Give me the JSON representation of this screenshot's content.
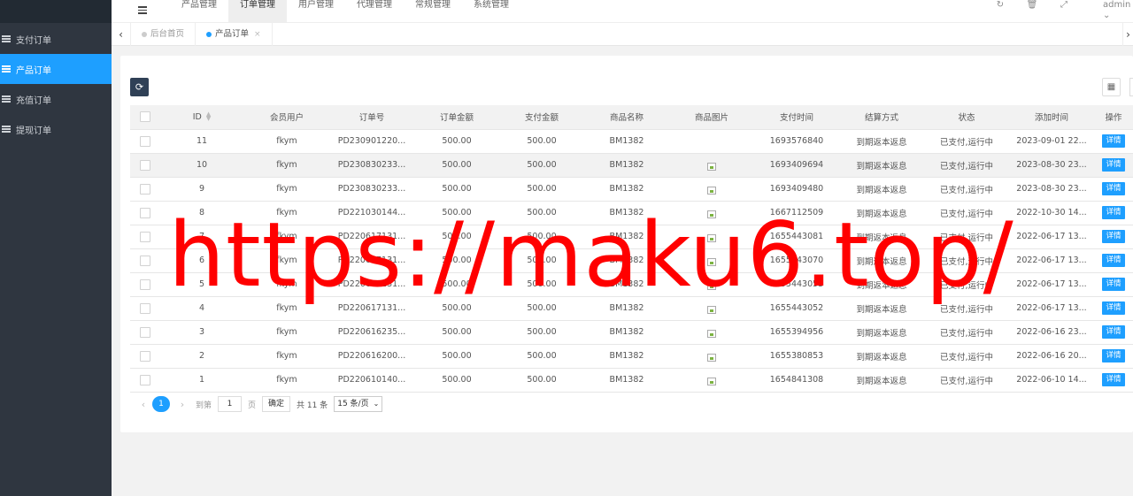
{
  "header": {
    "nav": [
      "产品管理",
      "订单管理",
      "用户管理",
      "代理管理",
      "常规管理",
      "系统管理"
    ],
    "active_nav": 1,
    "user": "admin"
  },
  "sidebar": {
    "items": [
      {
        "label": "支付订单",
        "active": false
      },
      {
        "label": "产品订单",
        "active": true
      },
      {
        "label": "充值订单",
        "active": false
      },
      {
        "label": "提现订单",
        "active": false
      }
    ]
  },
  "tabs": [
    {
      "label": "后台首页",
      "active": false
    },
    {
      "label": "产品订单",
      "active": true
    }
  ],
  "table": {
    "columns": [
      "",
      "ID",
      "会员用户",
      "订单号",
      "订单金额",
      "支付金额",
      "商品名称",
      "商品图片",
      "支付时间",
      "结算方式",
      "状态",
      "添加时间",
      "操作"
    ],
    "detail_label": "详情",
    "rows": [
      {
        "id": "11",
        "user": "fkym",
        "order_no": "PD230901220...",
        "amount": "500.00",
        "paid": "500.00",
        "product": "BM1382",
        "image": false,
        "pay_time": "1693576840",
        "settle": "到期返本返息",
        "status": "已支付,运行中",
        "added": "2023-09-01 22..."
      },
      {
        "id": "10",
        "user": "fkym",
        "order_no": "PD230830233...",
        "amount": "500.00",
        "paid": "500.00",
        "product": "BM1382",
        "image": true,
        "pay_time": "1693409694",
        "settle": "到期返本返息",
        "status": "已支付,运行中",
        "added": "2023-08-30 23..."
      },
      {
        "id": "9",
        "user": "fkym",
        "order_no": "PD230830233...",
        "amount": "500.00",
        "paid": "500.00",
        "product": "BM1382",
        "image": true,
        "pay_time": "1693409480",
        "settle": "到期返本返息",
        "status": "已支付,运行中",
        "added": "2023-08-30 23..."
      },
      {
        "id": "8",
        "user": "fkym",
        "order_no": "PD221030144...",
        "amount": "500.00",
        "paid": "500.00",
        "product": "BM1382",
        "image": true,
        "pay_time": "1667112509",
        "settle": "到期返本返息",
        "status": "已支付,运行中",
        "added": "2022-10-30 14..."
      },
      {
        "id": "7",
        "user": "fkym",
        "order_no": "PD220617131...",
        "amount": "500.00",
        "paid": "500.00",
        "product": "BM1382",
        "image": true,
        "pay_time": "1655443081",
        "settle": "到期返本返息",
        "status": "已支付,运行中",
        "added": "2022-06-17 13..."
      },
      {
        "id": "6",
        "user": "fkym",
        "order_no": "PD220617131...",
        "amount": "500.00",
        "paid": "500.00",
        "product": "BM1382",
        "image": true,
        "pay_time": "1655443070",
        "settle": "到期返本返息",
        "status": "已支付,运行中",
        "added": "2022-06-17 13..."
      },
      {
        "id": "5",
        "user": "fkym",
        "order_no": "PD220617131...",
        "amount": "500.00",
        "paid": "500.00",
        "product": "BM1382",
        "image": true,
        "pay_time": "1655443053",
        "settle": "到期返本返息",
        "status": "已支付,运行中",
        "added": "2022-06-17 13..."
      },
      {
        "id": "4",
        "user": "fkym",
        "order_no": "PD220617131...",
        "amount": "500.00",
        "paid": "500.00",
        "product": "BM1382",
        "image": true,
        "pay_time": "1655443052",
        "settle": "到期返本返息",
        "status": "已支付,运行中",
        "added": "2022-06-17 13..."
      },
      {
        "id": "3",
        "user": "fkym",
        "order_no": "PD220616235...",
        "amount": "500.00",
        "paid": "500.00",
        "product": "BM1382",
        "image": true,
        "pay_time": "1655394956",
        "settle": "到期返本返息",
        "status": "已支付,运行中",
        "added": "2022-06-16 23..."
      },
      {
        "id": "2",
        "user": "fkym",
        "order_no": "PD220616200...",
        "amount": "500.00",
        "paid": "500.00",
        "product": "BM1382",
        "image": true,
        "pay_time": "1655380853",
        "settle": "到期返本返息",
        "status": "已支付,运行中",
        "added": "2022-06-16 20..."
      },
      {
        "id": "1",
        "user": "fkym",
        "order_no": "PD220610140...",
        "amount": "500.00",
        "paid": "500.00",
        "product": "BM1382",
        "image": true,
        "pay_time": "1654841308",
        "settle": "到期返本返息",
        "status": "已支付,运行中",
        "added": "2022-06-10 14..."
      }
    ]
  },
  "pagination": {
    "current": "1",
    "goto_label": "到第",
    "page_value": "1",
    "page_unit": "页",
    "confirm": "确定",
    "total": "共 11 条",
    "page_size": "15 条/页"
  },
  "watermark": "https://maku6.top/",
  "colors": {
    "accent": "#1e9fff",
    "sidebar_bg": "#2f3640",
    "watermark": "#ff0000"
  }
}
